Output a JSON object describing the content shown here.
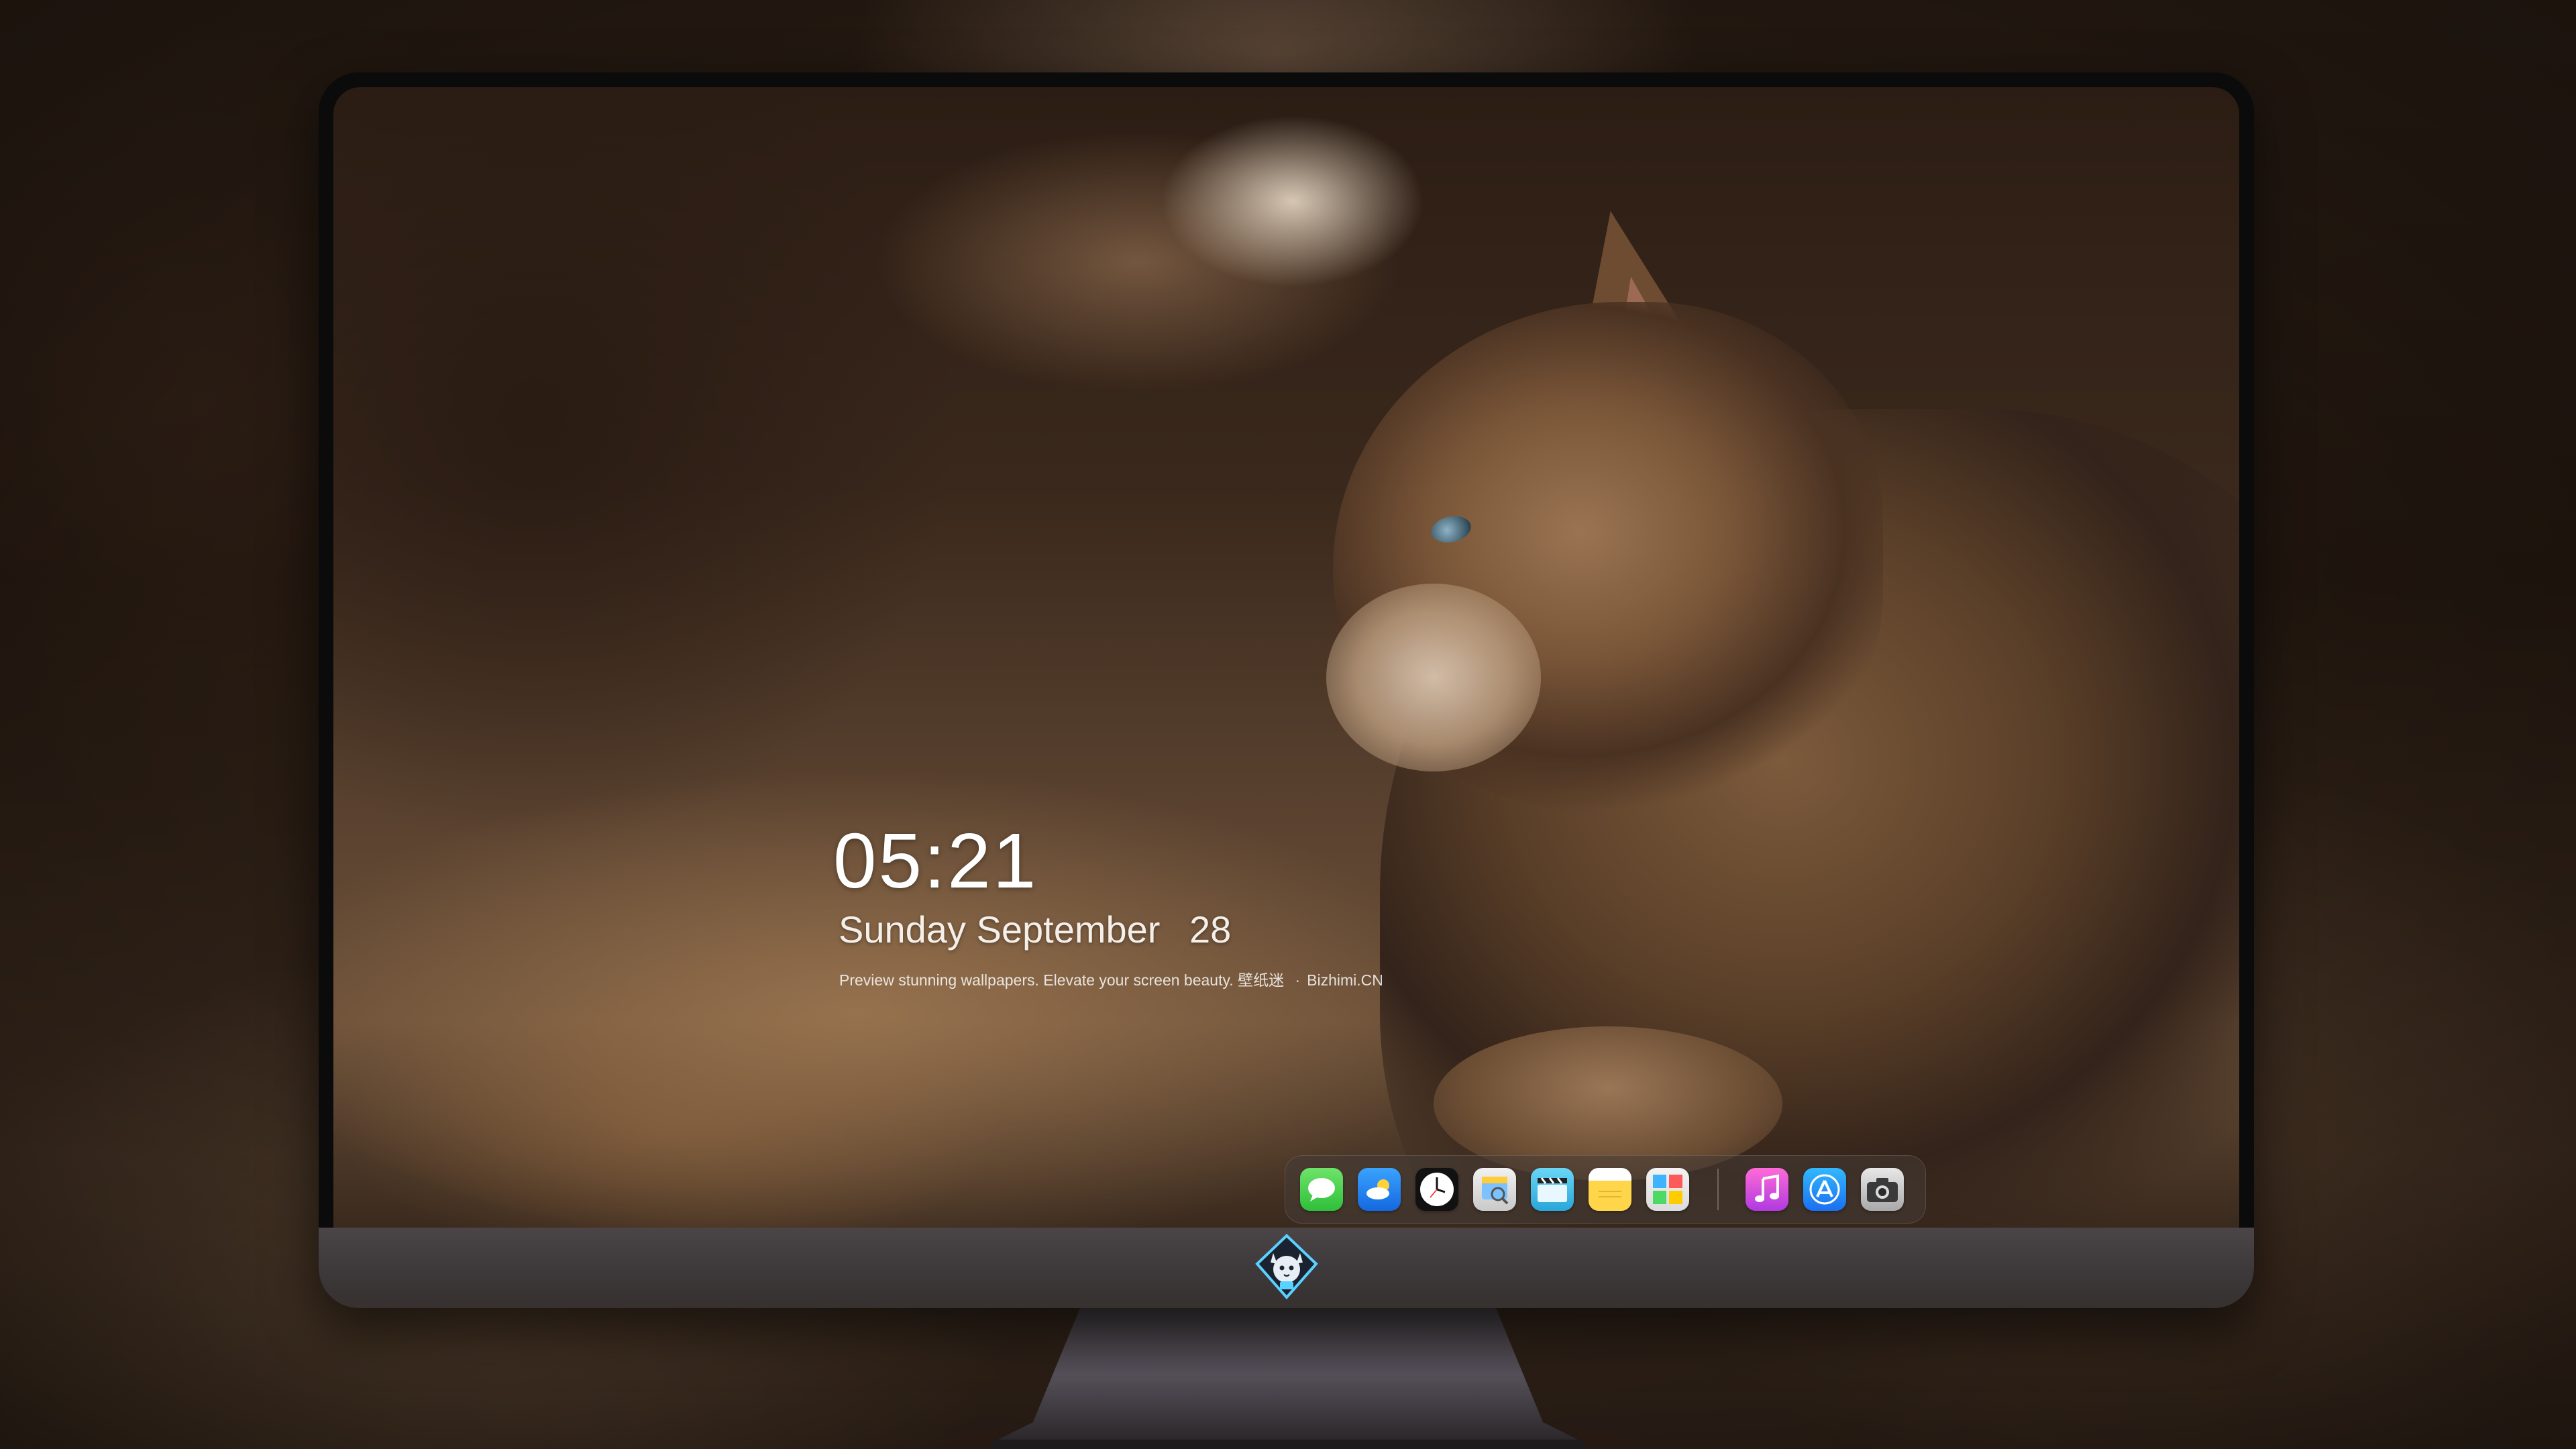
{
  "lock_screen": {
    "time": "05:21",
    "weekday": "Sunday",
    "month": "September",
    "day": "28",
    "tagline": "Preview stunning wallpapers. Elevate your screen beauty.",
    "brand_cn": "壁纸迷",
    "separator": "·",
    "brand_site": "Bizhimi.CN"
  },
  "dock": {
    "apps": [
      {
        "name": "Messages",
        "icon": "messages-icon",
        "color": "#2fbf3a"
      },
      {
        "name": "Weather",
        "icon": "weather-icon",
        "color": "#1468e0"
      },
      {
        "name": "Clock",
        "icon": "clock-icon",
        "color": "#111111"
      },
      {
        "name": "Preview",
        "icon": "preview-icon",
        "color": "#c9c9c9"
      },
      {
        "name": "Clips",
        "icon": "clapperboard-icon",
        "color": "#2aa6da"
      },
      {
        "name": "Notes",
        "icon": "notes-icon",
        "color": "#ffd54a"
      },
      {
        "name": "Photos",
        "icon": "photos-icon",
        "color": "#dcdcdc"
      },
      {
        "name": "Music",
        "icon": "music-icon",
        "color": "#b03ae0"
      },
      {
        "name": "App Store",
        "icon": "appstore-icon",
        "color": "#1b6ff0"
      },
      {
        "name": "Camera",
        "icon": "camera-icon",
        "color": "#a9a9a9"
      }
    ]
  },
  "monitor": {
    "chin_logo": "cat-mascot-logo",
    "bezel_color": "#0b0b0b",
    "chin_color": "#3e393b"
  }
}
